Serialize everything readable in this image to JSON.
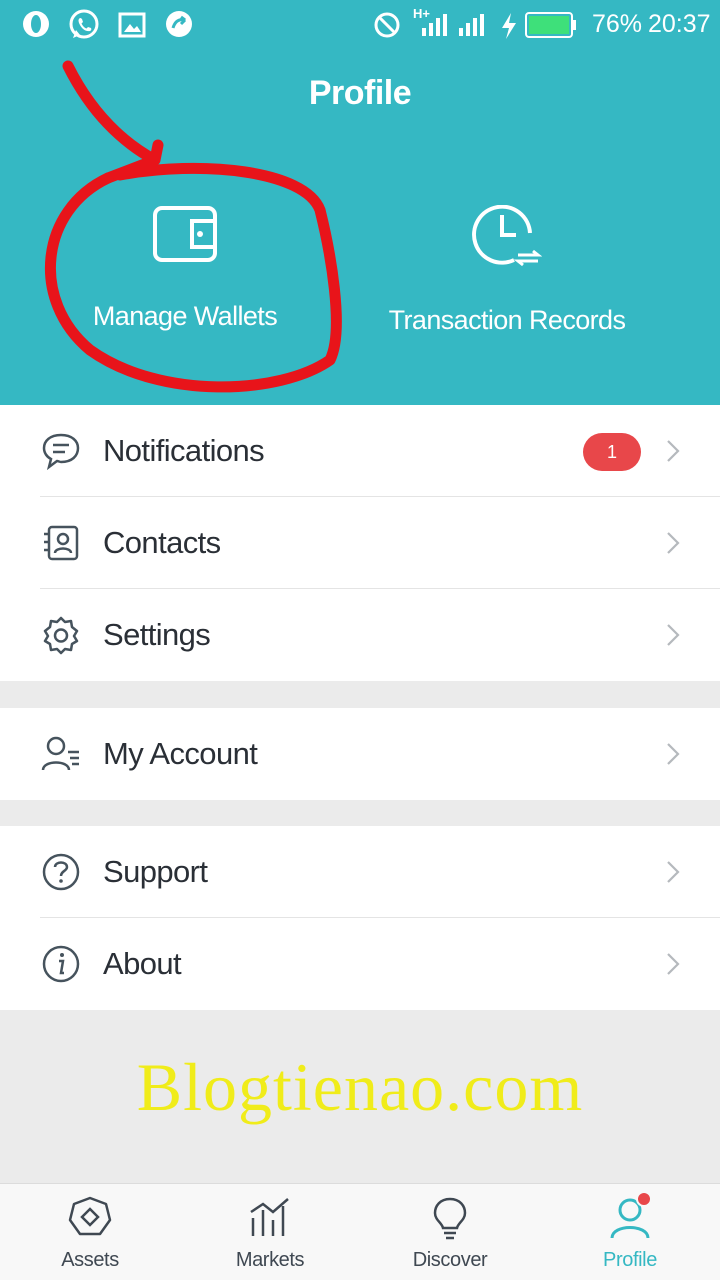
{
  "status_bar": {
    "battery": "76%",
    "time": "20:37",
    "network": "H+"
  },
  "header": {
    "title": "Profile",
    "background_color": "#35b8c3",
    "actions": [
      {
        "label": "Manage Wallets",
        "icon": "wallet-icon"
      },
      {
        "label": "Transaction Records",
        "icon": "clock-icon"
      }
    ]
  },
  "menu": {
    "group1": [
      {
        "label": "Notifications",
        "icon": "chat-bubble-icon",
        "badge": "1"
      },
      {
        "label": "Contacts",
        "icon": "contacts-book-icon"
      },
      {
        "label": "Settings",
        "icon": "gear-icon"
      }
    ],
    "group2": [
      {
        "label": "My Account",
        "icon": "user-account-icon"
      }
    ],
    "group3": [
      {
        "label": "Support",
        "icon": "question-icon"
      },
      {
        "label": "About",
        "icon": "info-icon"
      }
    ]
  },
  "watermark": "Blogtienao.com",
  "tabs": [
    {
      "label": "Assets",
      "icon": "hexagon-diamond-icon"
    },
    {
      "label": "Markets",
      "icon": "bar-chart-icon"
    },
    {
      "label": "Discover",
      "icon": "lightbulb-icon"
    },
    {
      "label": "Profile",
      "icon": "person-icon",
      "active": true
    }
  ],
  "colors": {
    "accent": "#35b8c3",
    "badge": "#e8474a",
    "annotation": "#e8141a",
    "watermark": "#f0ec1a"
  }
}
